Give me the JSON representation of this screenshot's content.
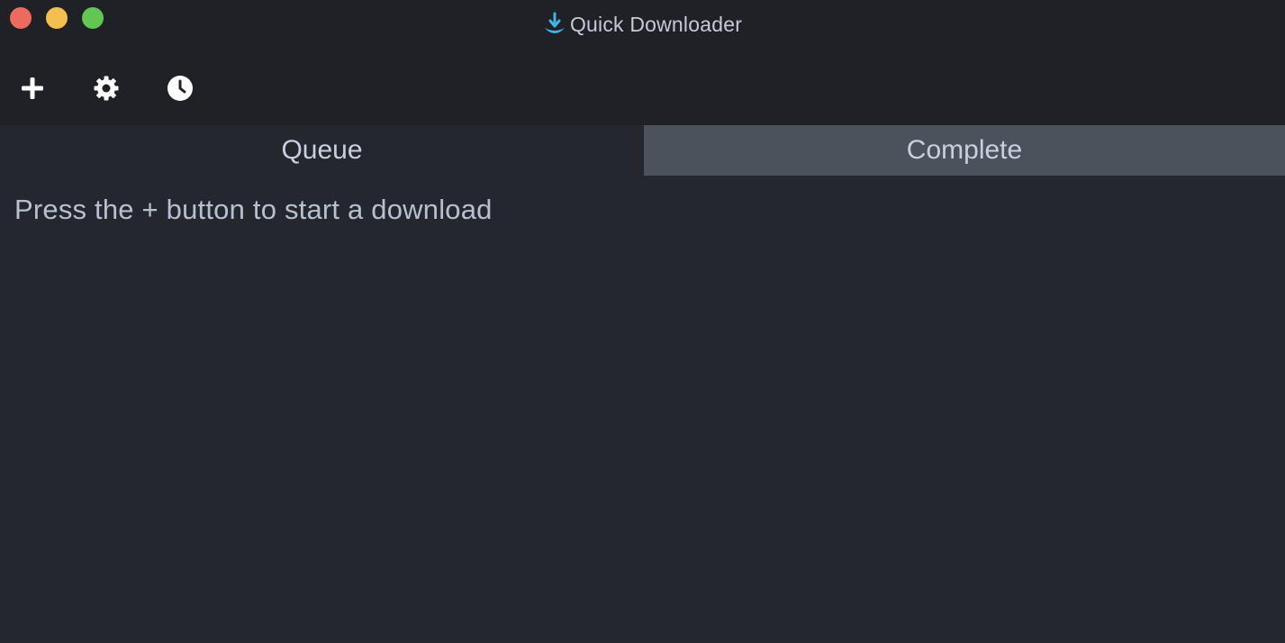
{
  "window": {
    "title": "Quick Downloader",
    "app_icon": "download-arrow-icon",
    "accent_color": "#3fb4e6"
  },
  "traffic_lights": {
    "close_color": "#ed6a5e",
    "minimize_color": "#f5bf4f",
    "maximize_color": "#62c554"
  },
  "toolbar": {
    "add_icon": "plus-icon",
    "settings_icon": "gear-icon",
    "history_icon": "clock-icon"
  },
  "tabs": [
    {
      "label": "Queue",
      "active": true
    },
    {
      "label": "Complete",
      "active": false
    }
  ],
  "main": {
    "empty_message": "Press the + button to start a download"
  }
}
